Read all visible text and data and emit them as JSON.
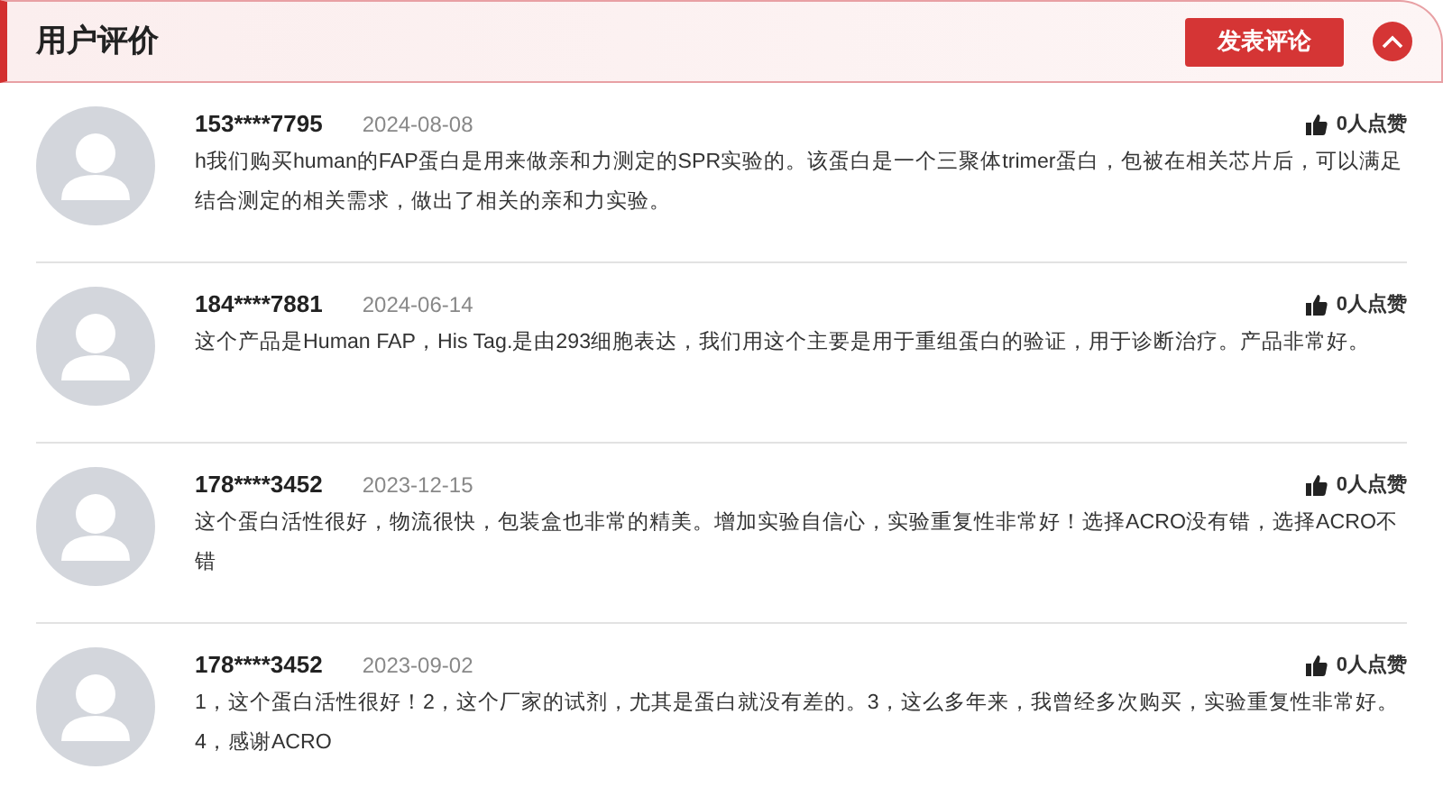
{
  "header": {
    "title": "用户评价",
    "post_button": "发表评论",
    "collapse_expanded": true
  },
  "reviews": [
    {
      "user": "153****7795",
      "date": "2024-08-08",
      "likes": "0人点赞",
      "text": "h我们购买human的FAP蛋白是用来做亲和力测定的SPR实验的。该蛋白是一个三聚体trimer蛋白，包被在相关芯片后，可以满足结合测定的相关需求，做出了相关的亲和力实验。"
    },
    {
      "user": "184****7881",
      "date": "2024-06-14",
      "likes": "0人点赞",
      "text": "这个产品是Human FAP，His Tag.是由293细胞表达，我们用这个主要是用于重组蛋白的验证，用于诊断治疗。产品非常好。"
    },
    {
      "user": "178****3452",
      "date": "2023-12-15",
      "likes": "0人点赞",
      "text": "这个蛋白活性很好，物流很快，包装盒也非常的精美。增加实验自信心，实验重复性非常好！选择ACRO没有错，选择ACRO不错"
    },
    {
      "user": "178****3452",
      "date": "2023-09-02",
      "likes": "0人点赞",
      "text": "1，这个蛋白活性很好！2，这个厂家的试剂，尤其是蛋白就没有差的。3，这么多年来，我曾经多次购买，实验重复性非常好。4，感谢ACRO"
    }
  ]
}
